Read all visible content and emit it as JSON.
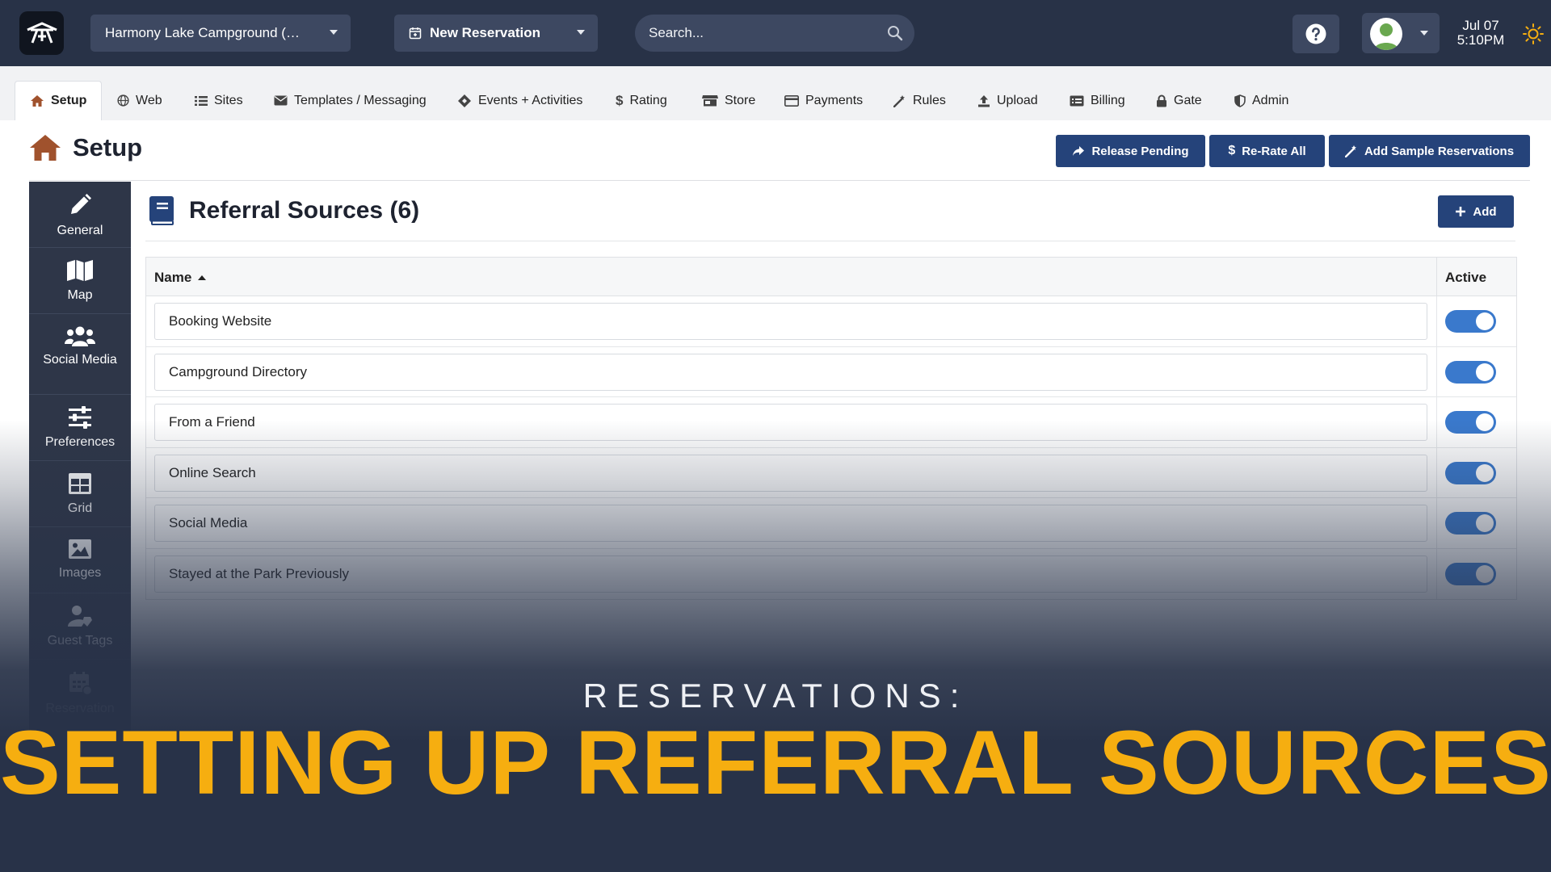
{
  "topbar": {
    "campground_label": "Harmony Lake Campground (…",
    "new_reservation_label": "New Reservation",
    "search_placeholder": "Search...",
    "date": "Jul 07",
    "time": "5:10PM"
  },
  "tabs": [
    {
      "label": "Setup",
      "icon": "home-icon",
      "active": true
    },
    {
      "label": "Web",
      "icon": "globe-icon"
    },
    {
      "label": "Sites",
      "icon": "list-icon"
    },
    {
      "label": "Templates / Messaging",
      "icon": "envelope-icon"
    },
    {
      "label": "Events + Activities",
      "icon": "ticket-icon"
    },
    {
      "label": "Rating",
      "icon": "dollar-icon"
    },
    {
      "label": "Store",
      "icon": "store-icon"
    },
    {
      "label": "Payments",
      "icon": "credit-card-icon"
    },
    {
      "label": "Rules",
      "icon": "magic-wand-icon"
    },
    {
      "label": "Upload",
      "icon": "upload-icon"
    },
    {
      "label": "Billing",
      "icon": "billing-icon"
    },
    {
      "label": "Gate",
      "icon": "lock-icon"
    },
    {
      "label": "Admin",
      "icon": "shield-icon"
    }
  ],
  "page": {
    "title": "Setup",
    "actions": {
      "release_pending": "Release Pending",
      "rerate_all": "Re-Rate All",
      "add_sample": "Add Sample Reservations"
    }
  },
  "sidebar": {
    "items": [
      {
        "label": "General",
        "icon": "pencil-icon"
      },
      {
        "label": "Map",
        "icon": "map-icon"
      },
      {
        "label": "Social Media",
        "icon": "users-icon"
      },
      {
        "label": "Preferences",
        "icon": "sliders-icon"
      },
      {
        "label": "Grid",
        "icon": "table-icon"
      },
      {
        "label": "Images",
        "icon": "image-icon"
      },
      {
        "label": "Guest Tags",
        "icon": "user-tag-icon"
      },
      {
        "label": "Reservation",
        "icon": "calendar-icon"
      }
    ]
  },
  "panel": {
    "title": "Referral Sources (6)",
    "add_label": "Add",
    "columns": {
      "name": "Name",
      "active": "Active"
    },
    "rows": [
      {
        "name": "Booking Website",
        "active": true
      },
      {
        "name": "Campground Directory",
        "active": true
      },
      {
        "name": "From a Friend",
        "active": true
      },
      {
        "name": "Online Search",
        "active": true
      },
      {
        "name": "Social Media",
        "active": true
      },
      {
        "name": "Stayed at the Park Previously",
        "active": true
      }
    ]
  },
  "overlay": {
    "kicker": "RESERVATIONS:",
    "headline": "SETTING UP REFERRAL SOURCES"
  },
  "colors": {
    "topbar": "#283247",
    "primary_button": "#25437a",
    "toggle_on": "#3a79cc",
    "headline": "#f6ae10",
    "home_icon": "#a0522d"
  }
}
